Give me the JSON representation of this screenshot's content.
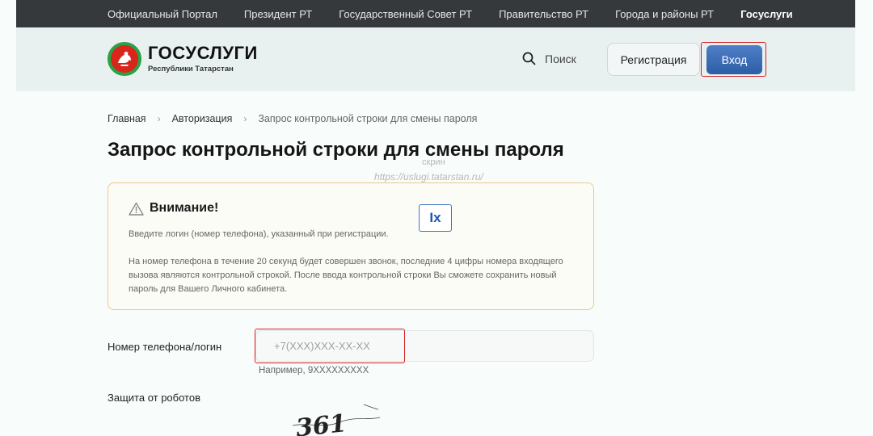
{
  "topnav": {
    "items": [
      {
        "label": "Официальный Портал"
      },
      {
        "label": "Президент РТ"
      },
      {
        "label": "Государственный Совет РТ"
      },
      {
        "label": "Правительство РТ"
      },
      {
        "label": "Города и районы РТ"
      },
      {
        "label": "Госуслуги",
        "active": true
      }
    ]
  },
  "header": {
    "logo_title": "ГОСУСЛУГИ",
    "logo_subtitle": "Республики Татарстан",
    "search_label": "Поиск",
    "register_label": "Регистрация",
    "login_label": "Вход"
  },
  "breadcrumb": {
    "items": [
      "Главная",
      "Авторизация",
      "Запрос контрольной строки для смены пароля"
    ]
  },
  "page": {
    "title": "Запрос контрольной строки для смены пароля",
    "watermark_1": "скрин",
    "watermark_2": "https://uslugi.tatarstan.ru/"
  },
  "warning": {
    "heading": "Внимание!",
    "text_1": "Введите логин (номер телефона), указанный при регистрации.",
    "text_2": "На номер телефона в течение 20 секунд будет совершен звонок, последние 4 цифры номера входящего вызова являются контрольной строкой. После ввода контрольной строки Вы сможете сохранить новый пароль для Вашего Личного кабинета."
  },
  "badge": {
    "label": "Ix"
  },
  "form": {
    "phone_label": "Номер телефона/логин",
    "phone_placeholder": "+7(XXX)XXX-XX-XX",
    "phone_value": "",
    "phone_hint": "Например, 9XXXXXXXXX",
    "captcha_label": "Защита от роботов",
    "captcha_text": "361"
  },
  "colors": {
    "topbar": "#36393c",
    "header_bg": "#e9f0f0",
    "login_button": "#3a6cb5",
    "warning_border": "#ecc98a",
    "highlight_red": "#d42222"
  }
}
